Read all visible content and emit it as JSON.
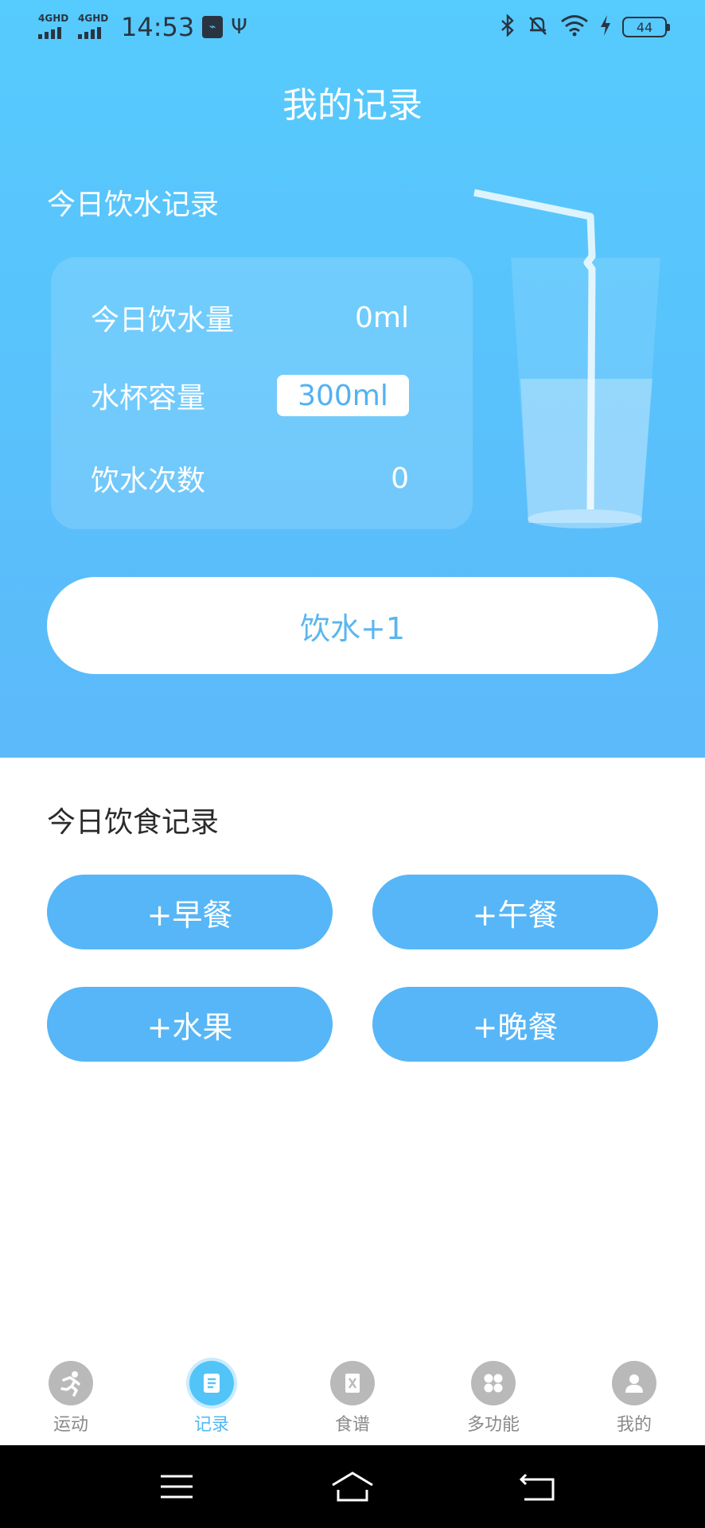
{
  "status_bar": {
    "net1": "4GHD",
    "net2": "4GHD",
    "time": "14:53",
    "battery": "44"
  },
  "page_title": "我的记录",
  "water": {
    "heading": "今日饮水记录",
    "intake_label": "今日饮水量",
    "intake_value": "0ml",
    "cup_label": "水杯容量",
    "cup_value": "300ml",
    "count_label": "饮水次数",
    "count_value": "0",
    "drink_button": "饮水+1"
  },
  "food": {
    "heading": "今日饮食记录",
    "buttons": [
      "+早餐",
      "+午餐",
      "+水果",
      "+晚餐"
    ]
  },
  "tabs": [
    {
      "label": "运动",
      "icon": "running-icon",
      "active": false
    },
    {
      "label": "记录",
      "icon": "record-book-icon",
      "active": true
    },
    {
      "label": "食谱",
      "icon": "recipe-icon",
      "active": false
    },
    {
      "label": "多功能",
      "icon": "grid-icon",
      "active": false
    },
    {
      "label": "我的",
      "icon": "person-icon",
      "active": false
    }
  ],
  "colors": {
    "hero_top": "#56cbfd",
    "hero_bottom": "#5cb9fa",
    "meal_button": "#56b6f7",
    "active_tab": "#52b8f5"
  }
}
